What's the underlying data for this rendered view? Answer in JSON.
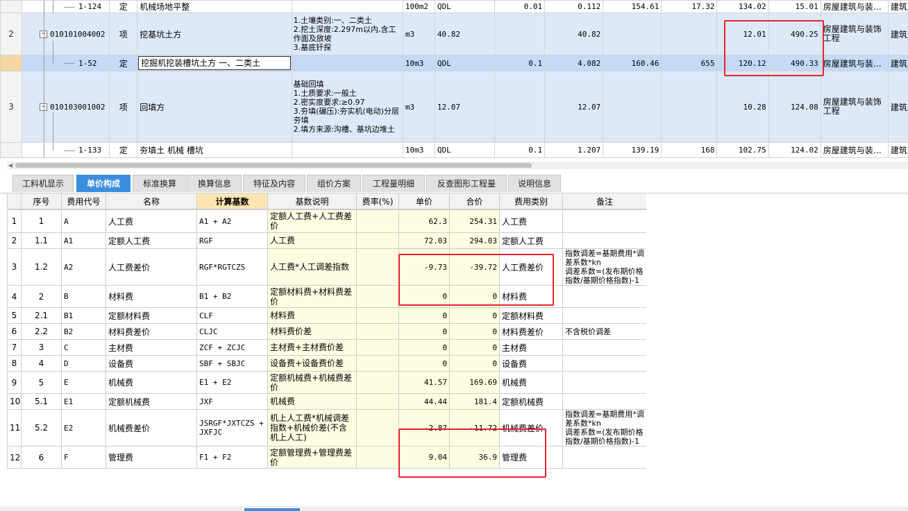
{
  "top_rows": [
    {
      "row": "",
      "code": "1-124",
      "type": "定",
      "name": "机械场地平整",
      "desc": "",
      "unit": "100m2",
      "expr": "QDL",
      "qty": "0.01",
      "amount": "0.112",
      "price": "154.61",
      "c9": "17.32",
      "unit_price": "134.02",
      "total": "15.01",
      "major": "房屋建筑与装…",
      "spec": "建筑工"
    },
    {
      "row": "2",
      "code": "010101004002",
      "type": "项",
      "name": "挖基坑土方",
      "desc": "1.土壤类别:一、二类土\n2.挖土深度:2.297m以内,含工作面及放坡\n3.基底钎探",
      "unit": "m3",
      "expr": "40.82",
      "qty": "",
      "amount": "40.82",
      "price": "",
      "c9": "",
      "unit_price": "12.01",
      "total": "490.25",
      "major": "房屋建筑与装饰工程",
      "spec": "建筑工"
    },
    {
      "row": "",
      "code": "1-52",
      "type": "定",
      "name": "挖掘机挖装槽坑土方 一、二类土",
      "desc": "",
      "unit": "10m3",
      "expr": "QDL",
      "qty": "0.1",
      "amount": "4.082",
      "price": "160.46",
      "c9": "655",
      "unit_price": "120.12",
      "total": "490.33",
      "major": "房屋建筑与装…",
      "spec": "建筑工"
    },
    {
      "row": "3",
      "code": "010103001002",
      "type": "项",
      "name": "回填方",
      "desc": "基础回填\n1.土质要求:一般土\n2.密实度要求:≥0.97\n3.夯填(碾压):夯实机(电动)分层夯填\n2.填方来源:沟槽、基坑边堆土",
      "unit": "m3",
      "expr": "12.07",
      "qty": "",
      "amount": "12.07",
      "price": "",
      "c9": "",
      "unit_price": "10.28",
      "total": "124.08",
      "major": "房屋建筑与装饰工程",
      "spec": "建筑工"
    },
    {
      "row": "",
      "code": "1-133",
      "type": "定",
      "name": "夯填土 机械 槽坑",
      "desc": "",
      "unit": "10m3",
      "expr": "QDL",
      "qty": "0.1",
      "amount": "1.207",
      "price": "139.19",
      "c9": "168",
      "unit_price": "102.75",
      "total": "124.02",
      "major": "房屋建筑与装…",
      "spec": "建筑工"
    }
  ],
  "tabs": [
    "工料机显示",
    "单价构成",
    "标准换算",
    "换算信息",
    "特征及内容",
    "组价方案",
    "工程量明细",
    "反查图形工程量",
    "说明信息"
  ],
  "active_tab": "单价构成",
  "bottom_headers": [
    "",
    "序号",
    "费用代号",
    "名称",
    "计算基数",
    "基数说明",
    "费率(%)",
    "单价",
    "合价",
    "费用类别",
    "备注"
  ],
  "bottom_rows": [
    {
      "n": "1",
      "seq": "1",
      "code": "A",
      "name": "人工费",
      "base": "A1 + A2",
      "basedesc": "定额人工费+人工费差价",
      "rate": "",
      "price": "62.3",
      "total": "254.31",
      "cat": "人工费",
      "remark": ""
    },
    {
      "n": "2",
      "seq": "1.1",
      "code": "A1",
      "name": "定额人工费",
      "base": "RGF",
      "basedesc": "人工费",
      "rate": "",
      "price": "72.03",
      "total": "294.03",
      "cat": "定额人工费",
      "remark": ""
    },
    {
      "n": "3",
      "seq": "1.2",
      "code": "A2",
      "name": "人工费差价",
      "base": "RGF*RGTCZS",
      "basedesc": "人工费*人工调差指数",
      "rate": "",
      "price": "-9.73",
      "total": "-39.72",
      "cat": "人工费差价",
      "remark": "指数调差=基期费用*调差系数*kn\n调差系数=(发布期价格指数/基期价格指数)-1"
    },
    {
      "n": "4",
      "seq": "2",
      "code": "B",
      "name": "材料费",
      "base": "B1 + B2",
      "basedesc": "定额材料费+材料费差价",
      "rate": "",
      "price": "0",
      "total": "0",
      "cat": "材料费",
      "remark": ""
    },
    {
      "n": "5",
      "seq": "2.1",
      "code": "B1",
      "name": "定额材料费",
      "base": "CLF",
      "basedesc": "材料费",
      "rate": "",
      "price": "0",
      "total": "0",
      "cat": "定额材料费",
      "remark": ""
    },
    {
      "n": "6",
      "seq": "2.2",
      "code": "B2",
      "name": "材料费差价",
      "base": "CLJC",
      "basedesc": "材料费价差",
      "rate": "",
      "price": "0",
      "total": "0",
      "cat": "材料费差价",
      "remark": "不含税价调差"
    },
    {
      "n": "7",
      "seq": "3",
      "code": "C",
      "name": "主材费",
      "base": "ZCF + ZCJC",
      "basedesc": "主材费+主材费价差",
      "rate": "",
      "price": "0",
      "total": "0",
      "cat": "主材费",
      "remark": ""
    },
    {
      "n": "8",
      "seq": "4",
      "code": "D",
      "name": "设备费",
      "base": "SBF + SBJC",
      "basedesc": "设备费+设备费价差",
      "rate": "",
      "price": "0",
      "total": "0",
      "cat": "设备费",
      "remark": ""
    },
    {
      "n": "9",
      "seq": "5",
      "code": "E",
      "name": "机械费",
      "base": "E1 + E2",
      "basedesc": "定额机械费+机械费差价",
      "rate": "",
      "price": "41.57",
      "total": "169.69",
      "cat": "机械费",
      "remark": ""
    },
    {
      "n": "10",
      "seq": "5.1",
      "code": "E1",
      "name": "定额机械费",
      "base": "JXF",
      "basedesc": "机械费",
      "rate": "",
      "price": "44.44",
      "total": "181.4",
      "cat": "定额机械费",
      "remark": ""
    },
    {
      "n": "11",
      "seq": "5.2",
      "code": "E2",
      "name": "机械费差价",
      "base": "JSRGF*JXTCZS + JXFJC",
      "basedesc": "机上人工费*机械调差指数+机械价差(不含机上人工)",
      "rate": "",
      "price": "-2.87",
      "total": "-11.72",
      "cat": "机械费差价",
      "remark": "指数调差=基期费用*调差系数*kn\n调差系数=(发布期价格指数/基期价格指数)-1"
    },
    {
      "n": "12",
      "seq": "6",
      "code": "F",
      "name": "管理费",
      "base": "F1 + F2",
      "basedesc": "定额管理费+管理费差价",
      "rate": "",
      "price": "9.04",
      "total": "36.9",
      "cat": "管理费",
      "remark": ""
    }
  ],
  "colors": {
    "accent": "#3c8de0",
    "highlight_box": "#e8222b",
    "selected_row": "#c4daf6",
    "list_row": "#dde9f9"
  }
}
